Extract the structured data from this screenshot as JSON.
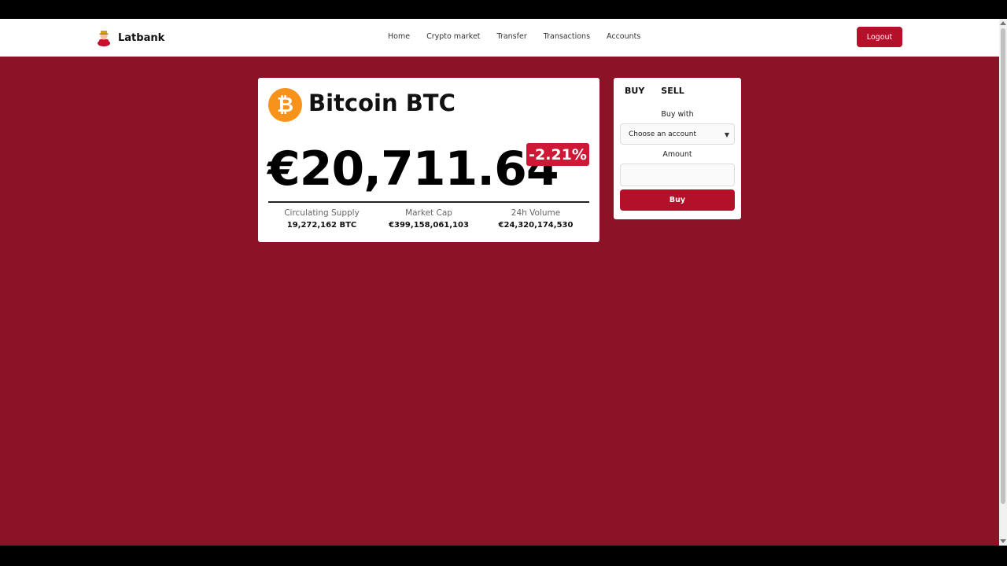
{
  "brand": {
    "name": "Latbank"
  },
  "nav": {
    "links": [
      {
        "label": "Home"
      },
      {
        "label": "Crypto market"
      },
      {
        "label": "Transfer"
      },
      {
        "label": "Transactions"
      },
      {
        "label": "Accounts"
      }
    ],
    "logout_label": "Logout"
  },
  "coin": {
    "icon_symbol": "₿",
    "icon": "bitcoin-icon",
    "name": "Bitcoin BTC",
    "price": "€20,711.64",
    "change": "-2.21%",
    "stats": [
      {
        "label": "Circulating Supply",
        "value": "19,272,162 BTC"
      },
      {
        "label": "Market Cap",
        "value": "€399,158,061,103"
      },
      {
        "label": "24h Volume",
        "value": "€24,320,174,530"
      }
    ]
  },
  "trade": {
    "tabs": [
      {
        "label": "BUY"
      },
      {
        "label": "SELL"
      }
    ],
    "buy_with_label": "Buy with",
    "account_select_value": "Choose an account",
    "amount_label": "Amount",
    "amount_value": "",
    "submit_label": "Buy"
  },
  "colors": {
    "background": "#8c1228",
    "accent": "#b3112a",
    "negative_change": "#cf1736",
    "bitcoin": "#f7931a"
  }
}
